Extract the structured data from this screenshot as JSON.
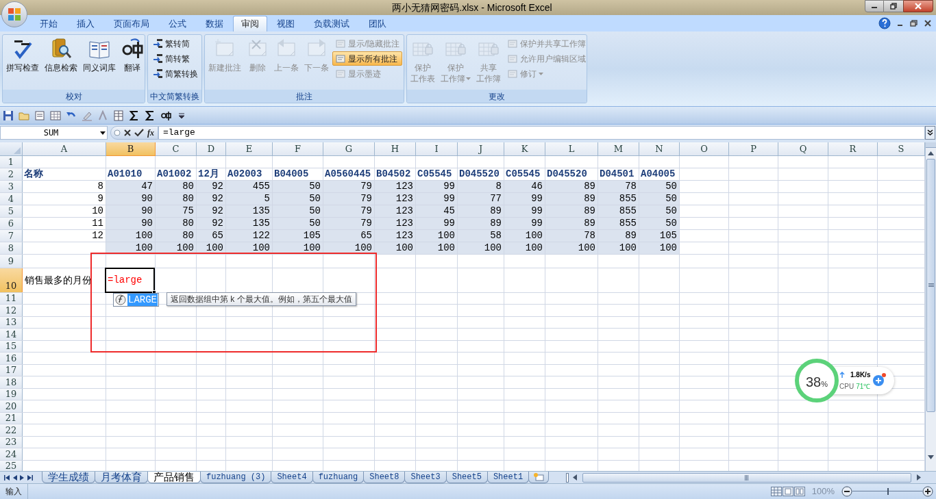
{
  "window": {
    "title": "两小无猜网密码.xlsx - Microsoft Excel"
  },
  "ribbon_tabs": [
    {
      "label": "开始",
      "selected": false
    },
    {
      "label": "插入",
      "selected": false
    },
    {
      "label": "页面布局",
      "selected": false
    },
    {
      "label": "公式",
      "selected": false
    },
    {
      "label": "数据",
      "selected": false
    },
    {
      "label": "审阅",
      "selected": true
    },
    {
      "label": "视图",
      "selected": false
    },
    {
      "label": "负载测试",
      "selected": false
    },
    {
      "label": "团队",
      "selected": false
    }
  ],
  "ribbon_groups": [
    {
      "label": "校对",
      "large_buttons": [
        {
          "lines": [
            "拼写检查"
          ],
          "disabled": false,
          "dropdown": false
        },
        {
          "lines": [
            "信息检索"
          ],
          "disabled": false,
          "dropdown": false
        },
        {
          "lines": [
            "同义词库"
          ],
          "disabled": false,
          "dropdown": false
        },
        {
          "lines": [
            "翻译"
          ],
          "disabled": false,
          "dropdown": false
        }
      ]
    },
    {
      "label": "中文简繁转换",
      "small_buttons": [
        {
          "label": "繁转简",
          "disabled": false,
          "selected": false,
          "dropdown": false
        },
        {
          "label": "简转繁",
          "disabled": false,
          "selected": false,
          "dropdown": false
        },
        {
          "label": "简繁转换",
          "disabled": false,
          "selected": false,
          "dropdown": false
        }
      ]
    },
    {
      "label": "批注",
      "large_buttons": [
        {
          "lines": [
            "新建批注"
          ],
          "disabled": true,
          "dropdown": false
        },
        {
          "lines": [
            "删除"
          ],
          "disabled": true,
          "dropdown": false
        },
        {
          "lines": [
            "上一条"
          ],
          "disabled": true,
          "dropdown": false
        },
        {
          "lines": [
            "下一条"
          ],
          "disabled": true,
          "dropdown": false
        }
      ],
      "small_buttons": [
        {
          "label": "显示/隐藏批注",
          "disabled": true,
          "selected": false,
          "dropdown": false
        },
        {
          "label": "显示所有批注",
          "disabled": false,
          "selected": true,
          "dropdown": false
        },
        {
          "label": "显示墨迹",
          "disabled": true,
          "selected": false,
          "dropdown": false
        }
      ]
    },
    {
      "label": "更改",
      "large_buttons": [
        {
          "lines": [
            "保护",
            "工作表"
          ],
          "disabled": true,
          "dropdown": false
        },
        {
          "lines": [
            "保护",
            "工作簿"
          ],
          "disabled": true,
          "dropdown": true
        },
        {
          "lines": [
            "共享",
            "工作簿"
          ],
          "disabled": true,
          "dropdown": false
        }
      ],
      "small_buttons": [
        {
          "label": "保护并共享工作簿",
          "disabled": true,
          "selected": false,
          "dropdown": false
        },
        {
          "label": "允许用户编辑区域",
          "disabled": true,
          "selected": false,
          "dropdown": false
        },
        {
          "label": "修订",
          "disabled": true,
          "selected": false,
          "dropdown": true
        }
      ]
    }
  ],
  "formula_bar": {
    "name_box": "SUM",
    "function_button": "fx",
    "formula": "=large"
  },
  "sheet": {
    "columns": [
      {
        "label": "A",
        "selected": false
      },
      {
        "label": "B",
        "selected": true
      },
      {
        "label": "C",
        "selected": false
      },
      {
        "label": "D",
        "selected": false
      },
      {
        "label": "E",
        "selected": false
      },
      {
        "label": "F",
        "selected": false
      },
      {
        "label": "G",
        "selected": false
      },
      {
        "label": "H",
        "selected": false
      },
      {
        "label": "I",
        "selected": false
      },
      {
        "label": "J",
        "selected": false
      },
      {
        "label": "K",
        "selected": false
      },
      {
        "label": "L",
        "selected": false
      },
      {
        "label": "M",
        "selected": false
      },
      {
        "label": "N",
        "selected": false
      },
      {
        "label": "O",
        "selected": false
      },
      {
        "label": "P",
        "selected": false
      },
      {
        "label": "Q",
        "selected": false
      },
      {
        "label": "R",
        "selected": false
      },
      {
        "label": "S",
        "selected": false
      }
    ],
    "rows": [
      {
        "number": "1",
        "selected": false
      },
      {
        "number": "2",
        "selected": false,
        "kind": "header",
        "highlighted": false,
        "label": "名称",
        "values": [
          "A01010",
          "A01002",
          "12月",
          "A02003",
          "B04005",
          "A0560445",
          "B04502",
          "C05545",
          "D045520",
          "C05545",
          "D045520",
          "D04501",
          "A04005"
        ]
      },
      {
        "number": "3",
        "selected": false,
        "kind": "data",
        "highlighted": true,
        "label": "8",
        "values": [
          "47",
          "80",
          "92",
          "455",
          "50",
          "79",
          "123",
          "99",
          "8",
          "46",
          "89",
          "78",
          "50"
        ]
      },
      {
        "number": "4",
        "selected": false,
        "kind": "data",
        "highlighted": true,
        "label": "9",
        "values": [
          "90",
          "80",
          "92",
          "5",
          "50",
          "79",
          "123",
          "99",
          "77",
          "99",
          "89",
          "855",
          "50"
        ]
      },
      {
        "number": "5",
        "selected": false,
        "kind": "data",
        "highlighted": true,
        "label": "10",
        "values": [
          "90",
          "75",
          "92",
          "135",
          "50",
          "79",
          "123",
          "45",
          "89",
          "99",
          "89",
          "855",
          "50"
        ]
      },
      {
        "number": "6",
        "selected": false,
        "kind": "data",
        "highlighted": true,
        "label": "11",
        "values": [
          "90",
          "80",
          "92",
          "135",
          "50",
          "79",
          "123",
          "99",
          "89",
          "99",
          "89",
          "855",
          "50"
        ]
      },
      {
        "number": "7",
        "selected": false,
        "kind": "data",
        "highlighted": true,
        "label": "12",
        "values": [
          "100",
          "80",
          "65",
          "122",
          "105",
          "65",
          "123",
          "100",
          "58",
          "100",
          "78",
          "89",
          "105"
        ]
      },
      {
        "number": "8",
        "selected": false,
        "kind": "data",
        "highlighted": true,
        "values": [
          "100",
          "100",
          "100",
          "100",
          "100",
          "100",
          "100",
          "100",
          "100",
          "100",
          "100",
          "100",
          "100"
        ]
      },
      {
        "number": "9",
        "selected": false
      },
      {
        "number": "10",
        "selected": true,
        "kind": "input",
        "highlighted": false,
        "label": "销售最多的月份",
        "values": [
          "=large"
        ]
      },
      {
        "number": "11",
        "selected": false
      },
      {
        "number": "12",
        "selected": false
      },
      {
        "number": "13",
        "selected": false
      },
      {
        "number": "14",
        "selected": false
      },
      {
        "number": "15",
        "selected": false
      },
      {
        "number": "16",
        "selected": false
      },
      {
        "number": "17",
        "selected": false
      },
      {
        "number": "18",
        "selected": false
      },
      {
        "number": "19",
        "selected": false
      },
      {
        "number": "20",
        "selected": false
      },
      {
        "number": "21",
        "selected": false
      },
      {
        "number": "22",
        "selected": false
      },
      {
        "number": "23",
        "selected": false
      },
      {
        "number": "24",
        "selected": false
      },
      {
        "number": "25",
        "selected": false
      }
    ]
  },
  "autocomplete": {
    "items": [
      {
        "label": "LARGE",
        "selected": true
      }
    ],
    "tooltip": "返回数据组中第 k 个最大值。例如，第五个最大值"
  },
  "sheet_tabs": [
    {
      "label": "学生成绩",
      "selected": false
    },
    {
      "label": "月考体育",
      "selected": false
    },
    {
      "label": "产品销售",
      "selected": true
    },
    {
      "label": "fuzhuang (3)",
      "selected": false
    },
    {
      "label": "Sheet4",
      "selected": false
    },
    {
      "label": "fuzhuang",
      "selected": false
    },
    {
      "label": "Sheet8",
      "selected": false
    },
    {
      "label": "Sheet3",
      "selected": false
    },
    {
      "label": "Sheet5",
      "selected": false
    },
    {
      "label": "Sheet1",
      "selected": false
    }
  ],
  "status_bar": {
    "mode": "输入",
    "zoom": "100%",
    "zoom_slider": {
      "level": 0.5
    }
  },
  "system_monitor": {
    "cpu_usage": "38",
    "unit": "%",
    "network_speed": "1.8K/s",
    "cpu_label": "CPU",
    "cpu_temperature": "71℃"
  }
}
